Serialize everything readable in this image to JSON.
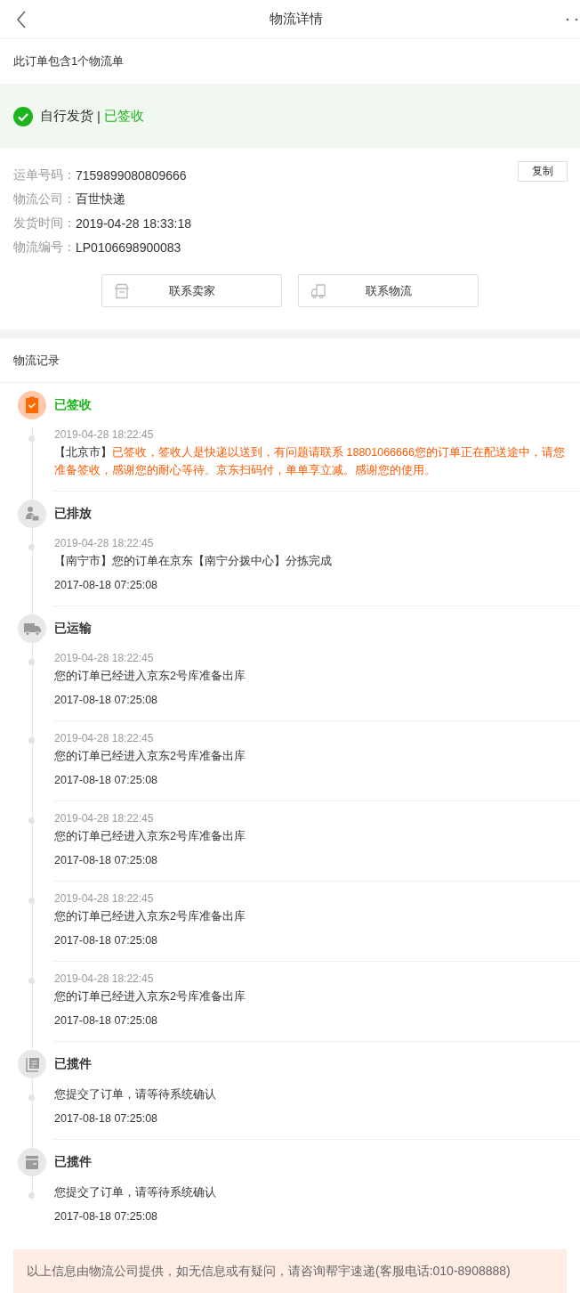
{
  "header": {
    "title": "物流详情"
  },
  "order_summary": "此订单包含1个物流单",
  "status": {
    "method": "自行发货",
    "separator": "|",
    "state": "已签收",
    "done": true
  },
  "info": [
    {
      "label": "运单号码：",
      "value": "7159899080809666"
    },
    {
      "label": "物流公司：",
      "value": "百世快递"
    },
    {
      "label": "发货时间：",
      "value": "2019-04-28 18:33:18"
    },
    {
      "label": "物流编号：",
      "value": "LP0106698900083"
    }
  ],
  "copy_button": "复制",
  "actions": [
    {
      "label": "联系卖家",
      "kind": "shop"
    },
    {
      "label": "联系物流",
      "kind": "truck"
    }
  ],
  "records_title": "物流记录",
  "timeline": [
    {
      "title": "已签收",
      "kind": "clipboard",
      "active": true,
      "entries": [
        {
          "time": "2019-04-28 18:22:45",
          "city": "【北京市】",
          "text": "已签收，签收人是快递以送到，有问题请联系 18801066666您的订单正在配送途中，请您准备签收，感谢您的耐心等待。京东扫码付，单单享立减。感谢您的使用。"
        }
      ]
    },
    {
      "title": "已排放",
      "kind": "courier",
      "active": false,
      "entries": [
        {
          "time": "2019-04-28 18:22:45",
          "text": "【南宁市】您的订单在京东【南宁分拨中心】分拣完成",
          "date": "2017-08-18 07:25:08"
        }
      ]
    },
    {
      "title": "已运输",
      "kind": "truck",
      "active": false,
      "entries": [
        {
          "time": "2019-04-28 18:22:45",
          "text": "您的订单已经进入京东2号库准备出库",
          "date": "2017-08-18 07:25:08"
        },
        {
          "time": "2019-04-28 18:22:45",
          "text": "您的订单已经进入京东2号库准备出库",
          "date": "2017-08-18 07:25:08"
        },
        {
          "time": "2019-04-28 18:22:45",
          "text": "您的订单已经进入京东2号库准备出库",
          "date": "2017-08-18 07:25:08"
        },
        {
          "time": "2019-04-28 18:22:45",
          "text": "您的订单已经进入京东2号库准备出库",
          "date": "2017-08-18 07:25:08"
        },
        {
          "time": "2019-04-28 18:22:45",
          "text": "您的订单已经进入京东2号库准备出库",
          "date": "2017-08-18 07:25:08"
        }
      ]
    },
    {
      "title": "已揽件",
      "kind": "list",
      "active": false,
      "entries": [
        {
          "text": "您提交了订单，请等待系统确认",
          "date": "2017-08-18 07:25:08"
        }
      ]
    },
    {
      "title": "已揽件",
      "kind": "box",
      "active": false,
      "entries": [
        {
          "text": "您提交了订单，请等待系统确认",
          "date": "2017-08-18 07:25:08"
        }
      ]
    }
  ],
  "notice": "以上信息由物流公司提供，如无信息或有疑问，请咨询帮宇速递(客服电话:010-8908888)"
}
